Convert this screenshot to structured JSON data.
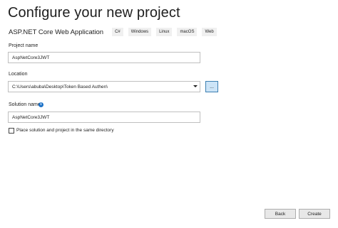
{
  "header": {
    "title": "Configure your new project"
  },
  "template": {
    "name": "ASP.NET Core Web Application",
    "tags": [
      "C#",
      "Windows",
      "Linux",
      "macOS",
      "Web"
    ]
  },
  "project_name": {
    "label": "Project name",
    "value": "AspNetCore3JWT"
  },
  "location": {
    "label": "Location",
    "value": "C:\\Users\\abuba\\Desktop\\Token Based Authen\\",
    "browse_label": "..."
  },
  "solution_name": {
    "label": "Solution name",
    "info_icon": "info-icon",
    "value": "AspNetCore3JWT"
  },
  "same_directory": {
    "label": "Place solution and project in the same directory",
    "checked": false
  },
  "footer": {
    "back_label": "Back",
    "create_label": "Create"
  }
}
